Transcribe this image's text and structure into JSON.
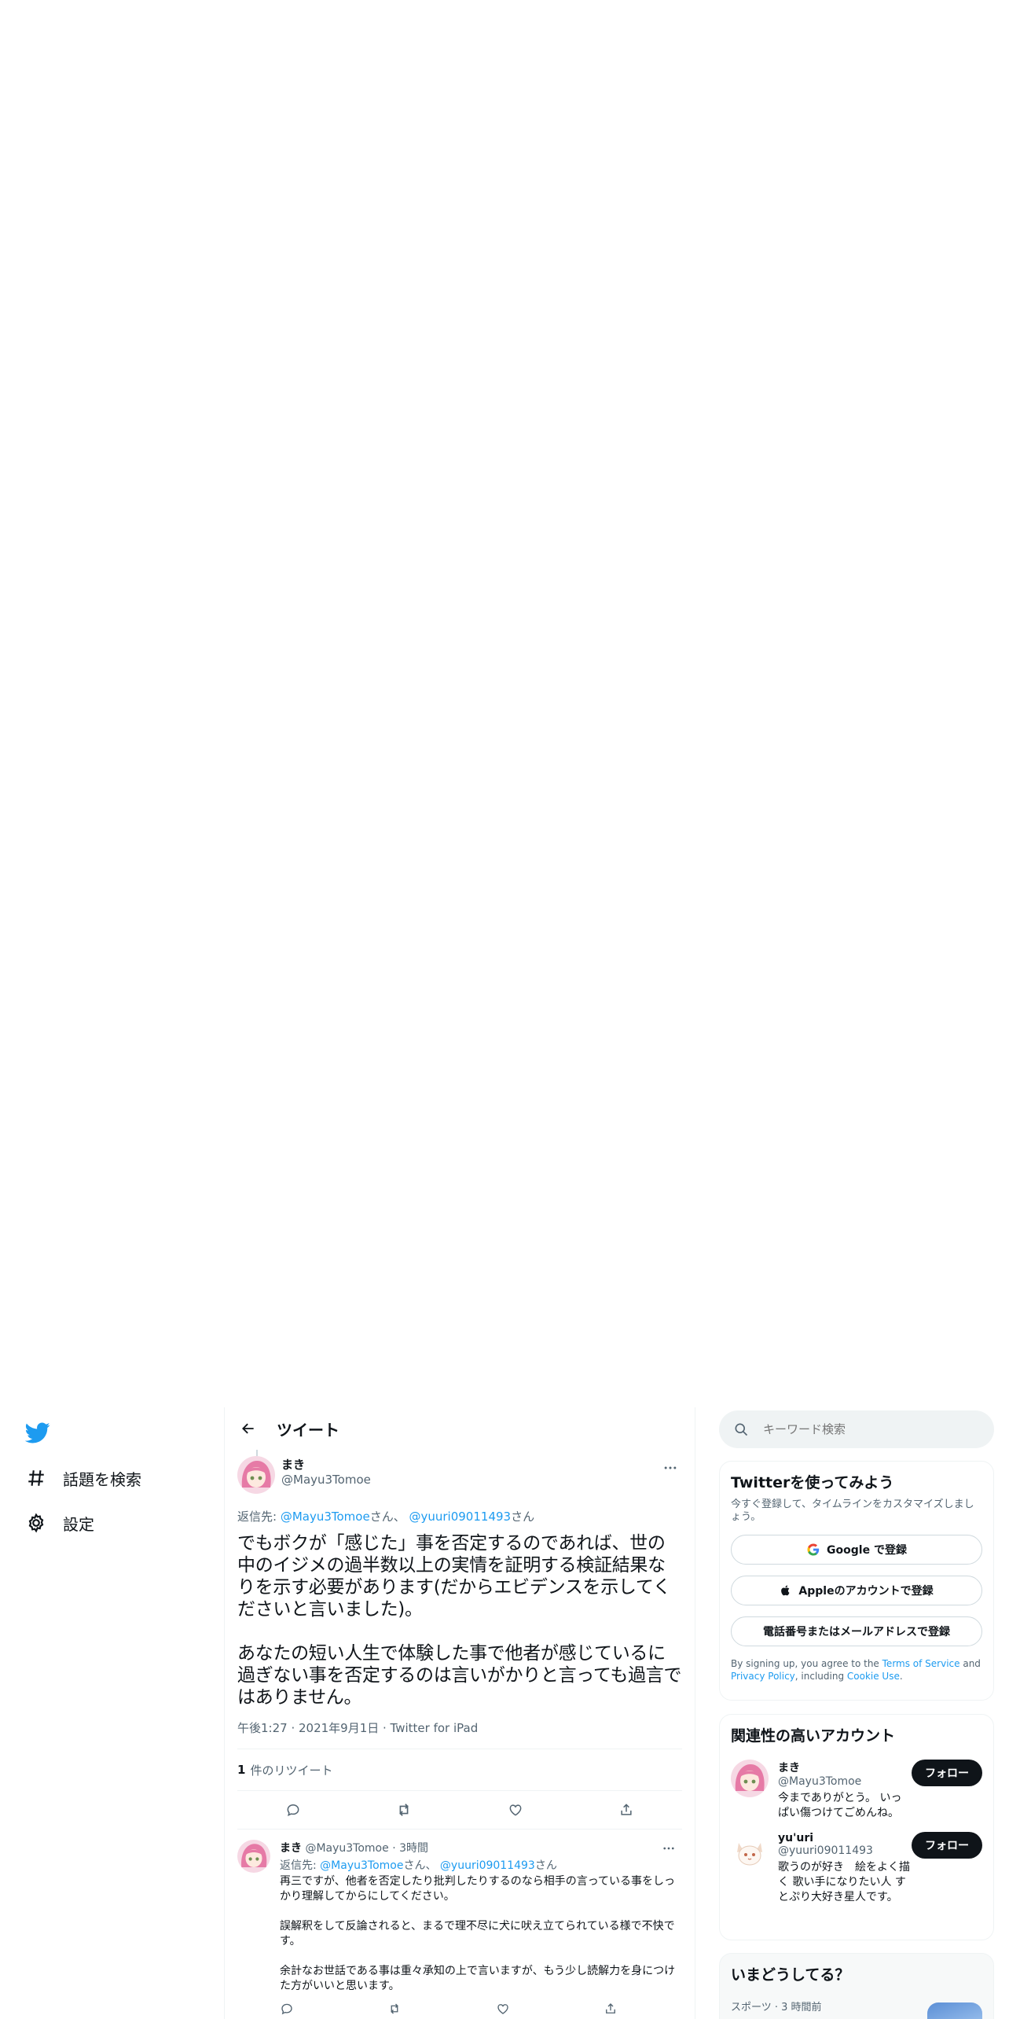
{
  "nav": {
    "logo": "twitter-bird-icon",
    "items": [
      {
        "icon": "hashtag-icon",
        "label": "話題を検索"
      },
      {
        "icon": "gear-icon",
        "label": "設定"
      }
    ]
  },
  "header": {
    "title": "ツイート",
    "back_icon": "back-arrow-icon"
  },
  "tweet": {
    "display_name": "まき",
    "handle": "@Mayu3Tomoe",
    "replying_prefix": "返信先: ",
    "replying_to_1": "@Mayu3Tomoe",
    "replying_san_1": "さん、",
    "replying_to_2": "@yuuri09011493",
    "replying_san_2": "さん",
    "text": "でもボクが「感じた」事を否定するのであれば、世の中のイジメの過半数以上の実情を証明する検証結果なりを示す必要があります(だからエビデンスを示してくださいと言いました)。\n\nあなたの短い人生で体験した事で他者が感じているに過ぎない事を否定するのは言いがかりと言っても過言ではありません。",
    "timestamp": "午後1:27 · 2021年9月1日 · Twitter for iPad",
    "retweet_count": "1",
    "retweet_label": "件のリツイート"
  },
  "reply": {
    "display_name": "まき",
    "handle": "@Mayu3Tomoe",
    "time": "· 3時間",
    "replying_prefix": "返信先: ",
    "replying_to_1": "@Mayu3Tomoe",
    "replying_san_1": "さん、",
    "replying_to_2": "@yuuri09011493",
    "replying_san_2": "さん",
    "text": "再三ですが、他者を否定したり批判したりするのなら相手の言っている事をしっかり理解してからにしてください。\n\n誤解釈をして反論されると、まるで理不尽に犬に吠え立てられている様で不快です。\n\n余計なお世話である事は重々承知の上で言いますが、もう少し読解力を身につけた方がいいと思います。"
  },
  "search": {
    "placeholder": "キーワード検索"
  },
  "signup": {
    "title": "Twitterを使ってみよう",
    "subtitle": "今すぐ登録して、タイムラインをカスタマイズしましょう。",
    "google_label": "Google で登録",
    "apple_label": "Appleのアカウントで登録",
    "phone_label": "電話番号またはメールアドレスで登録",
    "legal_1": "By signing up, you agree to the ",
    "tos": "Terms of Service",
    "legal_2": " and ",
    "privacy": "Privacy Policy",
    "legal_3": ", including ",
    "cookie": "Cookie Use",
    "legal_4": "."
  },
  "related": {
    "title": "関連性の高いアカウント",
    "accounts": [
      {
        "name": "まき",
        "handle": "@Mayu3Tomoe",
        "bio": "今までありがとう。 いっぱい傷つけてごめんね。",
        "follow": "フォロー"
      },
      {
        "name": "yu'uri",
        "handle": "@yuuri09011493",
        "bio": "歌うのが好き　絵をよく描く 歌い手になりたい人 すとぷり大好き星人です。",
        "follow": "フォロー"
      }
    ]
  },
  "trends": {
    "title": "いまどうしてる？",
    "meta": "スポーツ · 3 時間前"
  },
  "colors": {
    "accent": "#1d9bf0",
    "text": "#0f1419",
    "muted": "#536471"
  }
}
